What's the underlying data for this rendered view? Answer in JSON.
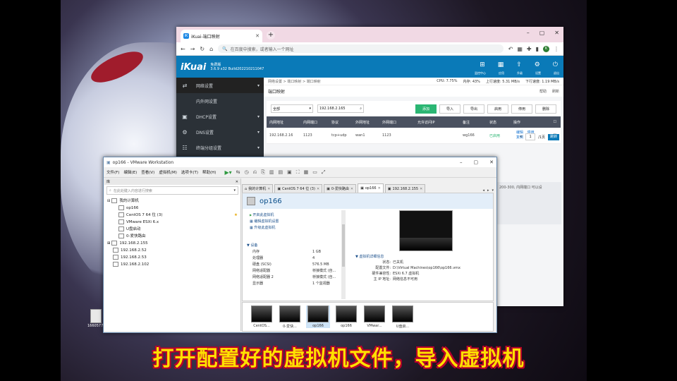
{
  "browser": {
    "tab_title": "iKuai-端口映射",
    "tab_icon": "iK",
    "address_placeholder": "在百度中搜索，或者输入一个网址",
    "avatar_letter": "K"
  },
  "ikuai": {
    "logo": "iKuai",
    "edition": "免费版",
    "version": "3.6.9 x32 Build202210211047",
    "header_icons": [
      "monitor-icon",
      "apps-icon",
      "upgrade-icon",
      "settings-icon",
      "logout-icon"
    ],
    "header_labels": [
      "监控中心",
      "应用",
      "升级",
      "设置",
      "退出"
    ],
    "sidebar": [
      {
        "label": "网络设置",
        "icon": "network-icon"
      },
      {
        "label": "内外网设置",
        "icon": ""
      },
      {
        "label": "DHCP设置",
        "icon": "dhcp-icon"
      },
      {
        "label": "DNS设置",
        "icon": "dns-icon"
      },
      {
        "label": "终端分组设置",
        "icon": "group-icon"
      }
    ],
    "breadcrumb": "网络设置 > 端口映射 > 端口映射",
    "status": {
      "cpu": "CPU: 7.75%",
      "mem": "内存: 43%",
      "up": "上行速度: 5.31 MB/s",
      "down": "下行速度: 1.19 MB/s"
    },
    "page_title": "端口映射",
    "page_actions": [
      "帮助",
      "刷新"
    ],
    "filter_select": "全部",
    "search_value": "192.168.2.165",
    "buttons": [
      "添加",
      "导入",
      "导出",
      "启用",
      "停用",
      "删除"
    ],
    "table_headers": [
      "内网地址",
      "内网端口",
      "协议",
      "外网地址",
      "外网端口",
      "允许访问IP",
      "备注",
      "状态",
      "操作"
    ],
    "rows": [
      {
        "ip": "192.168.2.16",
        "port": "1123",
        "proto": "tcp+udp",
        "wan": "wan1",
        "wan_port": "1123",
        "allow": "",
        "remark": "wg166",
        "status": "已启用",
        "ops": [
          "编辑",
          "停用",
          "复制",
          "删除"
        ]
      }
    ],
    "pager": {
      "prev": "<",
      "page": "1",
      "suffix": "/1页",
      "jump": "跳转"
    },
    "info_text": "200-300, 内网端口 可以设"
  },
  "vmware": {
    "title": "op166 - VMware Workstation",
    "menu": [
      "文件(F)",
      "编辑(E)",
      "查看(V)",
      "虚拟机(M)",
      "选项卡(T)",
      "帮助(H)"
    ],
    "library_title": "库",
    "library_search": "在此处键入内容进行搜索",
    "tree": [
      {
        "label": "我的计算机",
        "indent": 0
      },
      {
        "label": "op166",
        "indent": 1
      },
      {
        "label": "CentOS 7 64 位 (3)",
        "indent": 1,
        "star": true
      },
      {
        "label": "VMware ESXi 6.x",
        "indent": 1
      },
      {
        "label": "U盘启动",
        "indent": 1
      },
      {
        "label": "0-爱快路由",
        "indent": 1
      },
      {
        "label": "192.168.2.155",
        "indent": 0
      },
      {
        "label": "192.168.2.52",
        "indent": 0
      },
      {
        "label": "192.168.2.53",
        "indent": 0
      },
      {
        "label": "192.168.2.102",
        "indent": 0
      }
    ],
    "tabs": [
      {
        "label": "我的计算机",
        "on": false
      },
      {
        "label": "CentOS 7 64 位 (3)",
        "on": false
      },
      {
        "label": "0-爱快路由",
        "on": false
      },
      {
        "label": "op166",
        "on": true
      },
      {
        "label": "192.168.2.155",
        "on": false
      }
    ],
    "vm_name": "op166",
    "actions": [
      "开启此虚拟机",
      "编辑虚拟机设置",
      "升级此虚拟机"
    ],
    "devices_title": "▼ 设备",
    "devices": [
      {
        "k": "内存",
        "v": "1 GB"
      },
      {
        "k": "处理器",
        "v": "4"
      },
      {
        "k": "硬盘 (SCSI)",
        "v": "576.5 MB"
      },
      {
        "k": "网络适配器",
        "v": "桥接模式 (自..."
      },
      {
        "k": "网络适配器 2",
        "v": "桥接模式 (自..."
      },
      {
        "k": "显示器",
        "v": "1 个监视器"
      }
    ],
    "details_title": "▼ 虚拟机详细信息",
    "details": [
      {
        "k": "状态:",
        "v": "已关机"
      },
      {
        "k": "配置文件:",
        "v": "D:\\Virtual Machines\\op166\\op166.vmx"
      },
      {
        "k": "硬件兼容性:",
        "v": "ESXi 6.7 虚拟机"
      },
      {
        "k": "主 IP 地址:",
        "v": "网络信息不可用"
      }
    ],
    "thumbs": [
      {
        "label": "CentOS...",
        "on": false
      },
      {
        "label": "0-爱快...",
        "on": false
      },
      {
        "label": "op166",
        "on": true
      },
      {
        "label": "op166",
        "on": false
      },
      {
        "label": "VMwar...",
        "on": false
      },
      {
        "label": "U盘启...",
        "on": false
      }
    ]
  },
  "desktop_icon_label": "16605776...",
  "caption": "打开配置好的虚拟机文件，导入虚拟机"
}
